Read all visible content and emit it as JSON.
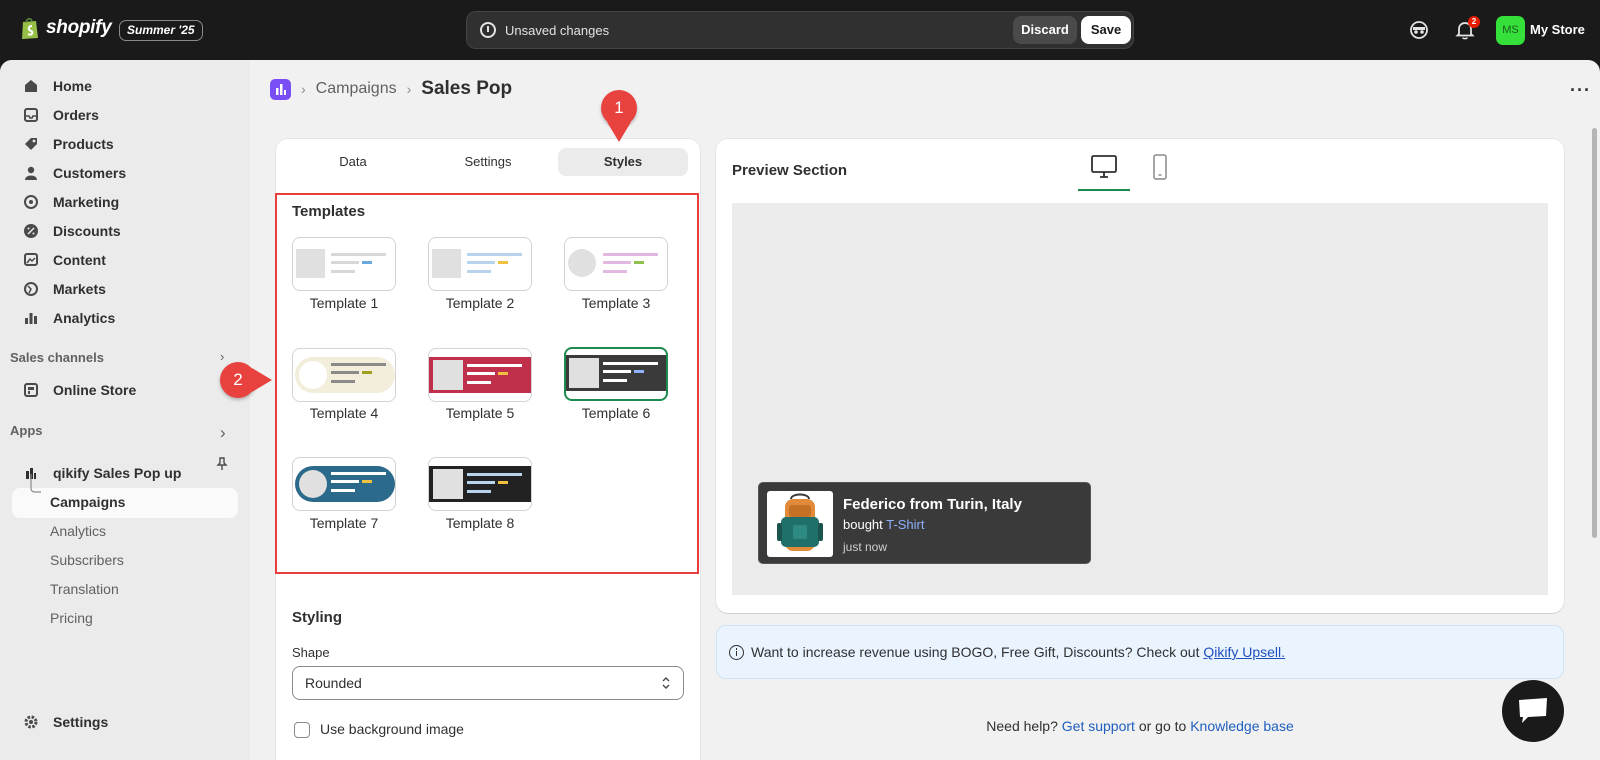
{
  "topbar": {
    "brand": "shopify",
    "season": "Summer '25",
    "unsaved_text": "Unsaved changes",
    "discard_label": "Discard",
    "save_label": "Save",
    "notification_count": "2",
    "avatar_initials": "MS",
    "store_name": "My Store"
  },
  "sidebar": {
    "items": [
      {
        "label": "Home",
        "icon": "home-icon"
      },
      {
        "label": "Orders",
        "icon": "inbox-icon"
      },
      {
        "label": "Products",
        "icon": "tag-icon"
      },
      {
        "label": "Customers",
        "icon": "person-icon"
      },
      {
        "label": "Marketing",
        "icon": "target-icon"
      },
      {
        "label": "Discounts",
        "icon": "discount-icon"
      },
      {
        "label": "Content",
        "icon": "image-icon"
      },
      {
        "label": "Markets",
        "icon": "globe-icon"
      },
      {
        "label": "Analytics",
        "icon": "bar-chart-icon"
      }
    ],
    "sales_channels_label": "Sales channels",
    "online_store_label": "Online Store",
    "apps_label": "Apps",
    "app_name": "qikify Sales Pop up",
    "app_subitems": [
      "Campaigns",
      "Analytics",
      "Subscribers",
      "Translation",
      "Pricing"
    ],
    "settings_label": "Settings"
  },
  "breadcrumb": {
    "parent": "Campaigns",
    "current": "Sales Pop"
  },
  "tabs": [
    "Data",
    "Settings",
    "Styles"
  ],
  "active_tab": "Styles",
  "templates": {
    "title": "Templates",
    "items": [
      "Template 1",
      "Template 2",
      "Template 3",
      "Template 4",
      "Template 5",
      "Template 6",
      "Template 7",
      "Template 8"
    ],
    "selected": "Template 6"
  },
  "styling": {
    "title": "Styling",
    "shape_label": "Shape",
    "shape_value": "Rounded",
    "bg_image_label": "Use background image",
    "bg_image_checked": false
  },
  "preview": {
    "title": "Preview Section",
    "active_device": "desktop",
    "popup": {
      "name": "Federico from Turin, Italy",
      "bought_prefix": "bought",
      "product": "T-Shirt",
      "time": "just now"
    }
  },
  "banner": {
    "text": "Want to increase revenue using BOGO, Free Gift, Discounts? Check out",
    "link": "Qikify Upsell."
  },
  "help": {
    "prefix": "Need help?",
    "support_link": "Get support",
    "middle": "or go to",
    "kb_link": "Knowledge base"
  },
  "callouts": [
    "1",
    "2"
  ],
  "colors": {
    "accent_green": "#1e8a4f",
    "callout_red": "#e8423f",
    "popup_bg": "#3a3a3a",
    "link_blue": "#1f4fbf"
  }
}
